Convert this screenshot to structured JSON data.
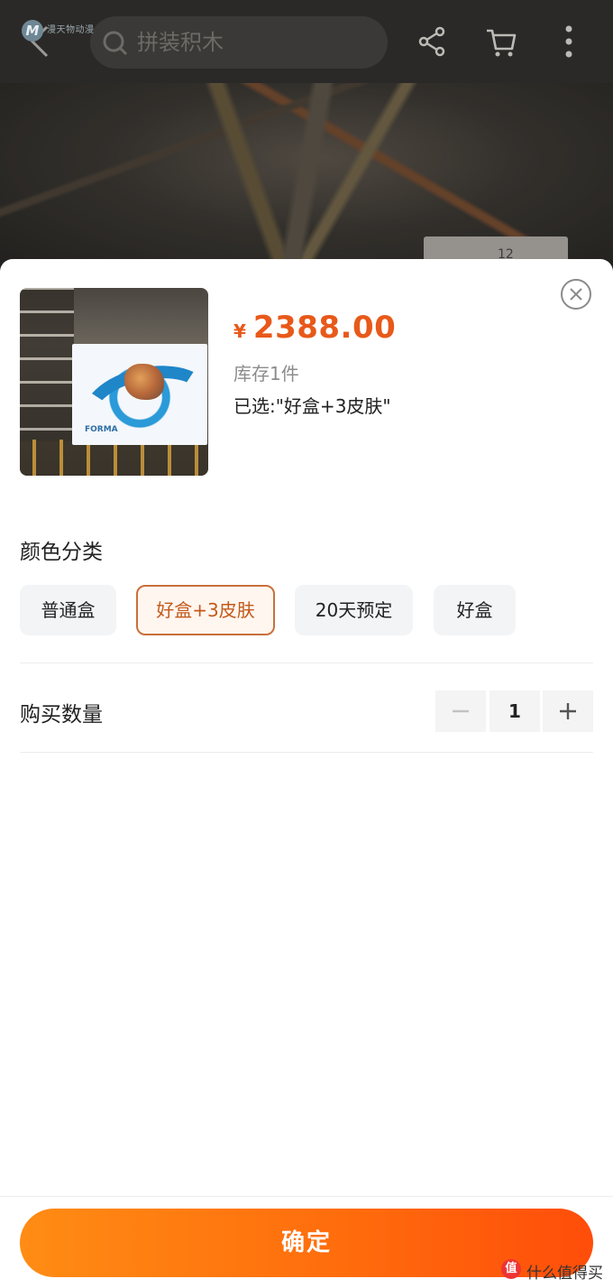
{
  "header": {
    "watermark_logo": "M",
    "watermark_text": "漫天物动漫",
    "search_placeholder": "拼装积木",
    "icons": [
      "back-arrow-icon",
      "search-icon",
      "share-icon",
      "cart-icon",
      "more-vertical-icon"
    ]
  },
  "backdrop": {
    "sign_text": "12"
  },
  "product": {
    "currency": "¥",
    "price": "2388.00",
    "stock": "库存1件",
    "selected": "已选:\"好盒+3皮肤\"",
    "price_color": "#e8591a"
  },
  "color_section": {
    "label": "颜色分类",
    "options": [
      "普通盒",
      "好盒+3皮肤",
      "20天预定",
      "好盒"
    ],
    "selected_index": 1
  },
  "quantity_section": {
    "label": "购买数量",
    "value": "1"
  },
  "footer": {
    "confirm_label": "确定",
    "accent_start": "#ff8c14",
    "accent_end": "#ff4d0a"
  },
  "watermark_bottom": {
    "badge": "值",
    "text": "什么值得买"
  }
}
